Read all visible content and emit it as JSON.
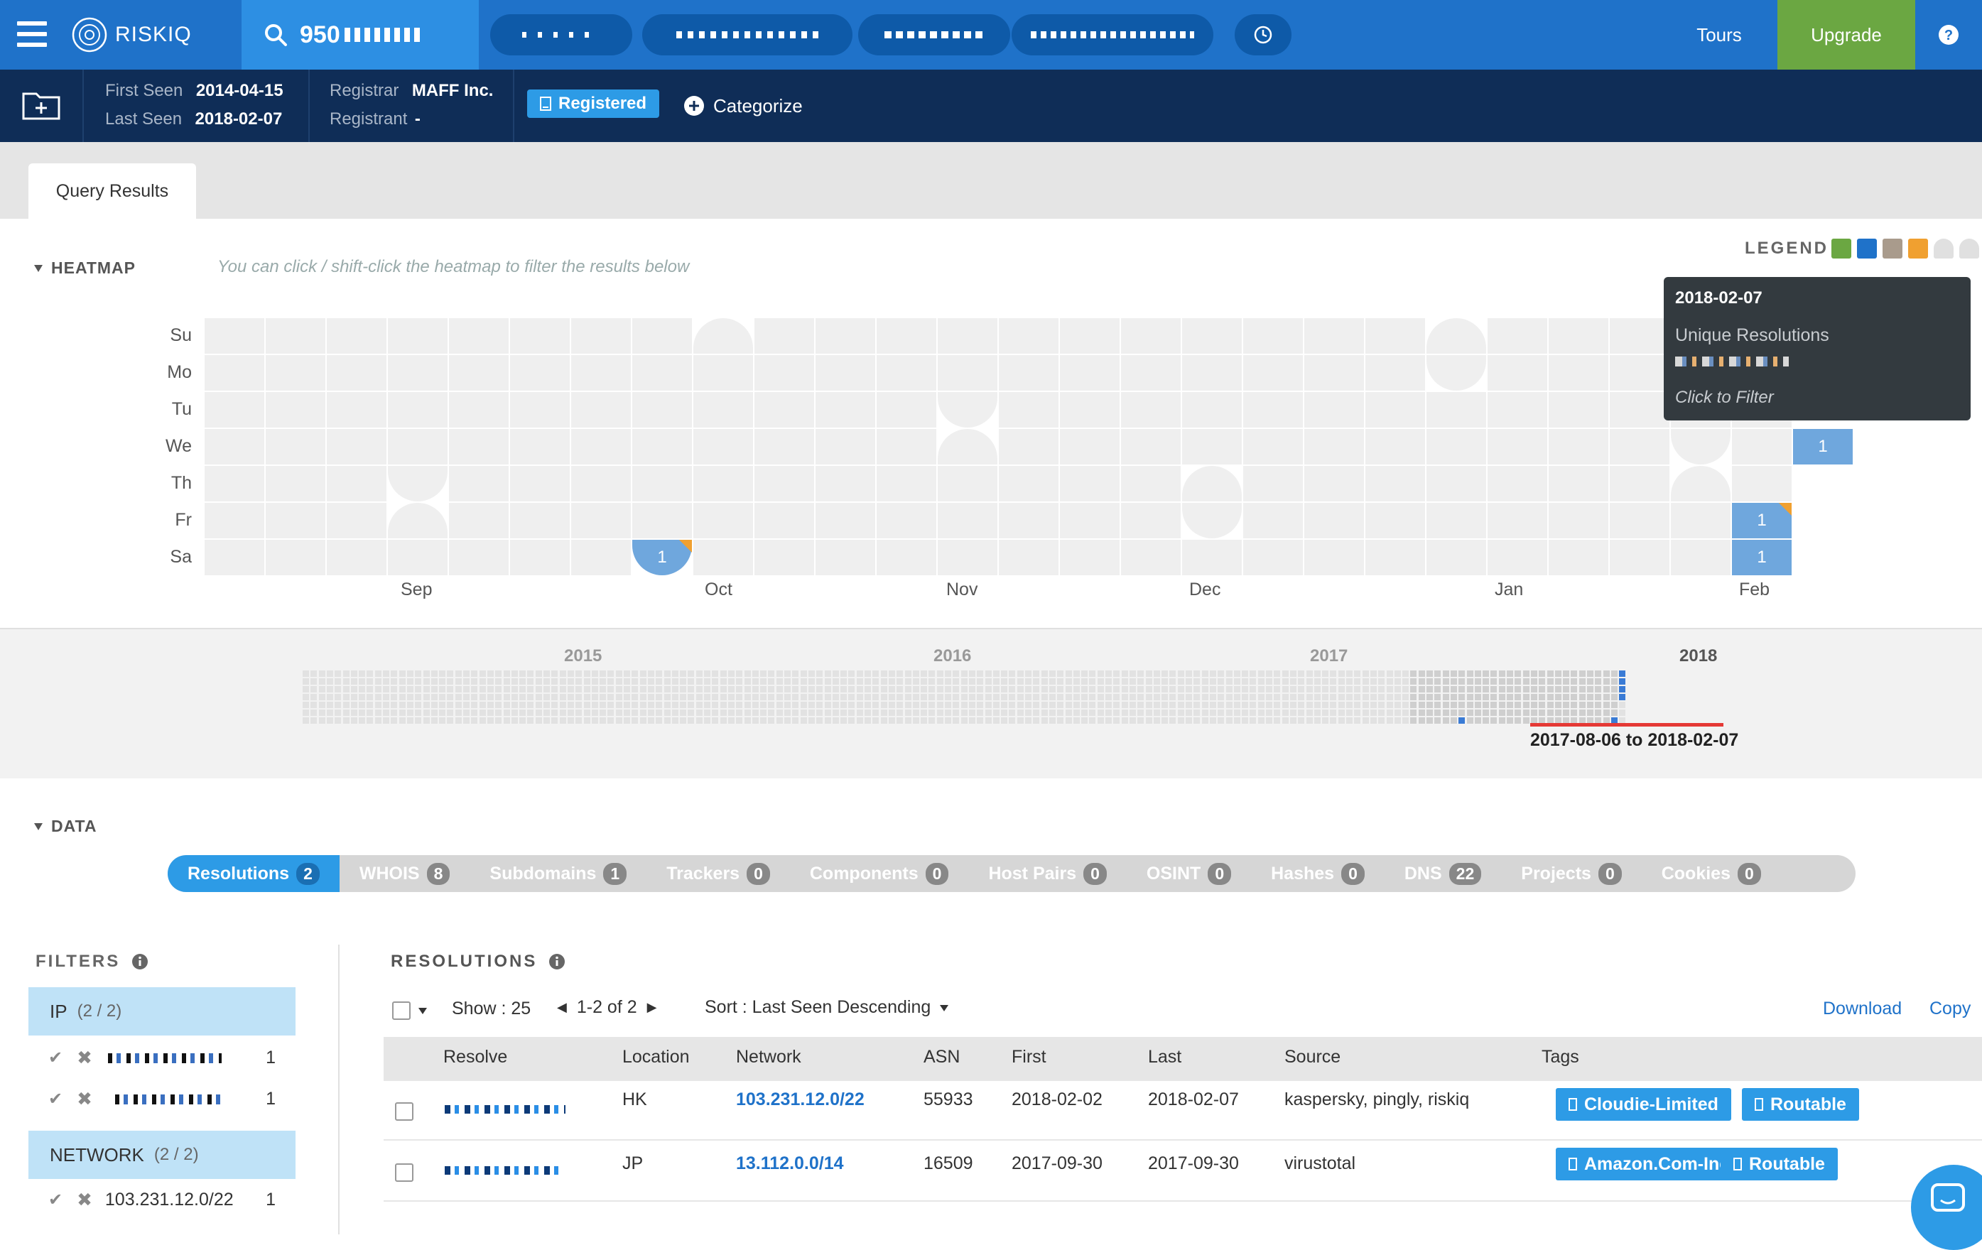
{
  "topbar": {
    "brand": "RISKIQ",
    "search_value": "950",
    "tours_label": "Tours",
    "upgrade_label": "Upgrade",
    "colors": {
      "bar": "#1f72c9",
      "search": "#2d8fe3",
      "upgrade": "#6ba742"
    }
  },
  "info": {
    "first_seen_label": "First Seen",
    "first_seen": "2014-04-15",
    "last_seen_label": "Last Seen",
    "last_seen": "2018-02-07",
    "registrar_label": "Registrar",
    "registrar": "MAFF Inc.",
    "registrant_label": "Registrant",
    "registrant": "-",
    "registered_badge": "Registered",
    "categorize_label": "Categorize"
  },
  "tabs": {
    "query_results": "Query Results"
  },
  "heatmap": {
    "title": "HEATMAP",
    "hint": "You can click / shift-click the heatmap to filter the results below",
    "legend_label": "LEGEND",
    "legend_colors": [
      "#6ba742",
      "#1f72c9",
      "#a99b8c",
      "#f0a030",
      "#e0e0e0",
      "#e0e0e0"
    ],
    "days": [
      "Su",
      "Mo",
      "Tu",
      "We",
      "Th",
      "Fr",
      "Sa"
    ],
    "months": [
      "Sep",
      "Oct",
      "Nov",
      "Dec",
      "Jan",
      "Feb"
    ],
    "marked_cells": [
      {
        "label": "1",
        "date": "Oct Sat"
      },
      {
        "label": "1",
        "date": "Feb Fri"
      },
      {
        "label": "1",
        "date": "Feb Sat"
      },
      {
        "label": "1",
        "date": "Feb We"
      }
    ],
    "tooltip": {
      "date": "2018-02-07",
      "heading": "Unique Resolutions",
      "action": "Click to Filter"
    }
  },
  "timeline": {
    "years": [
      "2015",
      "2016",
      "2017",
      "2018"
    ],
    "range": "2017-08-06 to 2018-02-07"
  },
  "data": {
    "title": "DATA",
    "tabs": [
      {
        "label": "Resolutions",
        "count": "2",
        "active": true
      },
      {
        "label": "WHOIS",
        "count": "8"
      },
      {
        "label": "Subdomains",
        "count": "1"
      },
      {
        "label": "Trackers",
        "count": "0"
      },
      {
        "label": "Components",
        "count": "0"
      },
      {
        "label": "Host Pairs",
        "count": "0"
      },
      {
        "label": "OSINT",
        "count": "0"
      },
      {
        "label": "Hashes",
        "count": "0"
      },
      {
        "label": "DNS",
        "count": "22"
      },
      {
        "label": "Projects",
        "count": "0"
      },
      {
        "label": "Cookies",
        "count": "0"
      }
    ]
  },
  "filters": {
    "title": "FILTERS",
    "ip_group": {
      "label": "IP",
      "count": "(2 / 2)",
      "rows": [
        {
          "count": "1"
        },
        {
          "count": "1"
        }
      ]
    },
    "network_group": {
      "label": "NETWORK",
      "count": "(2 / 2)",
      "rows": [
        {
          "value": "103.231.12.0/22",
          "count": "1"
        }
      ]
    }
  },
  "resolutions": {
    "title": "RESOLUTIONS",
    "show": "Show : 25",
    "paging": "1-2 of 2",
    "sort": "Sort : Last Seen Descending",
    "download": "Download",
    "copy": "Copy",
    "columns": [
      "Resolve",
      "Location",
      "Network",
      "ASN",
      "First",
      "Last",
      "Source",
      "Tags"
    ],
    "rows": [
      {
        "location": "HK",
        "network": "103.231.12.0/22",
        "asn": "55933",
        "first": "2018-02-02",
        "last": "2018-02-07",
        "source": "kaspersky, pingly, riskiq",
        "tags": [
          "Cloudie-Limited",
          "Routable"
        ]
      },
      {
        "location": "JP",
        "network": "13.112.0.0/14",
        "asn": "16509",
        "first": "2017-09-30",
        "last": "2017-09-30",
        "source": "virustotal",
        "tags": [
          "Amazon.Com-Inc.",
          "Routable"
        ]
      }
    ]
  }
}
